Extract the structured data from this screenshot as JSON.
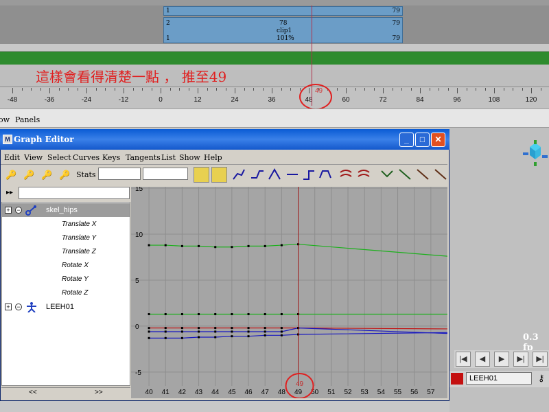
{
  "trax": {
    "row1": {
      "start": "1",
      "end": "79"
    },
    "clip": {
      "track": "2",
      "start": "1",
      "end": "79",
      "duration": "78",
      "name": "clip1",
      "scale": "101%",
      "end2": "79"
    }
  },
  "annotation": "這樣會看得清楚一點 ， 推至49",
  "ruler": {
    "ticks": [
      "-48",
      "-36",
      "-24",
      "-12",
      "0",
      "12",
      "24",
      "36",
      "48",
      "60",
      "72",
      "84",
      "96",
      "108",
      "120"
    ],
    "current": "49"
  },
  "main_menu": {
    "item1": "ow",
    "item2": "Panels"
  },
  "graph_editor": {
    "title": "Graph Editor",
    "title_icon": "M",
    "menus": [
      "Edit",
      "View",
      "Select",
      "Curves",
      "Keys",
      "Tangents",
      "List",
      "Show",
      "Help"
    ],
    "stats_label": "Stats",
    "outliner": {
      "root": "skel_hips",
      "curves": [
        {
          "label": "Translate X",
          "color": "#c01818"
        },
        {
          "label": "Translate Y",
          "color": "#1cb01c"
        },
        {
          "label": "Translate Z",
          "color": "#1818c0"
        },
        {
          "label": "Rotate X",
          "color": "#c01818"
        },
        {
          "label": "Rotate Y",
          "color": "#1cb01c"
        },
        {
          "label": "Rotate Z",
          "color": "#1818c0"
        }
      ],
      "node2": "LEEH01",
      "scroll_left": "<<",
      "scroll_right": ">>"
    },
    "current_frame": "49"
  },
  "chart_data": {
    "type": "line",
    "x_ticks": [
      40,
      41,
      42,
      43,
      44,
      45,
      46,
      47,
      48,
      49,
      50,
      51,
      52,
      53,
      54,
      55,
      56,
      57
    ],
    "y_ticks": [
      15,
      10,
      5,
      0,
      -5
    ],
    "xlim": [
      39.5,
      58
    ],
    "ylim": [
      -6.5,
      15
    ],
    "grid": true,
    "current_frame": 49,
    "series": [
      {
        "color": "#1cb01c",
        "x": [
          40,
          41,
          42,
          43,
          44,
          45,
          46,
          47,
          48,
          49,
          58
        ],
        "y": [
          8.8,
          8.8,
          8.7,
          8.7,
          8.6,
          8.6,
          8.7,
          8.7,
          8.8,
          8.9,
          7.6
        ]
      },
      {
        "color": "#1cb01c",
        "x": [
          40,
          41,
          42,
          43,
          44,
          45,
          46,
          47,
          48,
          49,
          58
        ],
        "y": [
          1.3,
          1.3,
          1.3,
          1.3,
          1.3,
          1.3,
          1.3,
          1.3,
          1.3,
          1.3,
          1.3
        ]
      },
      {
        "color": "#c01818",
        "x": [
          40,
          41,
          42,
          43,
          44,
          45,
          46,
          47,
          48,
          49,
          58
        ],
        "y": [
          -0.2,
          -0.2,
          -0.2,
          -0.2,
          -0.2,
          -0.2,
          -0.2,
          -0.2,
          -0.2,
          -0.2,
          -0.3
        ]
      },
      {
        "color": "#1818c0",
        "x": [
          40,
          41,
          42,
          43,
          44,
          45,
          46,
          47,
          48,
          49,
          58
        ],
        "y": [
          -0.6,
          -0.6,
          -0.6,
          -0.6,
          -0.6,
          -0.6,
          -0.6,
          -0.6,
          -0.6,
          -0.2,
          -0.8
        ]
      },
      {
        "color": "#1818c0",
        "x": [
          40,
          41,
          42,
          43,
          44,
          45,
          46,
          47,
          48,
          49,
          58
        ],
        "y": [
          -1.3,
          -1.3,
          -1.3,
          -1.2,
          -1.2,
          -1.1,
          -1.1,
          -1.0,
          -1.0,
          -0.9,
          -0.7
        ]
      }
    ]
  },
  "viewport": {
    "fps": "0.3 fp"
  },
  "char_field": "LEEH01"
}
